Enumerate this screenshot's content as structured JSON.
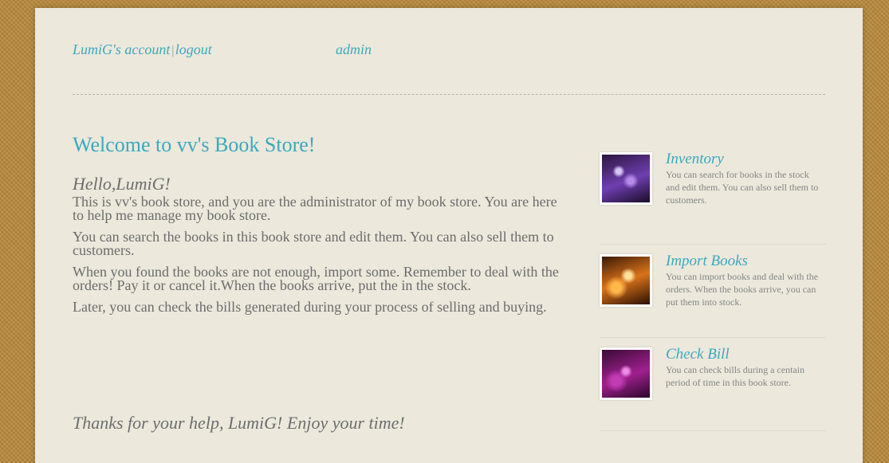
{
  "header": {
    "account_link": "LumiG's account",
    "separator": "|",
    "logout_link": "logout",
    "admin_link": "admin"
  },
  "main": {
    "welcome_title": "Welcome to vv's Book Store!",
    "greeting": "Hello,LumiG!",
    "paragraphs": [
      "This is vv's book store, and you are the administrator of my book store. You are here to help me manage my book store.",
      "You can search the books in this book store and edit them. You can also sell them to customers.",
      "When you found the books are not enough, import some. Remember to deal with the orders! Pay it or cancel it.When the books arrive, put the in the stock.",
      "Later, you can check the bills generated during your process of selling and buying."
    ],
    "thanks": "Thanks for your help, LumiG! Enjoy your time!"
  },
  "sidebar": {
    "items": [
      {
        "title": "Inventory",
        "description": "You can search for books in the stock and edit them. You can also sell them to customers.",
        "icon": "purple-bokeh-thumbnail"
      },
      {
        "title": "Import Books",
        "description": "You can import books and deal with the orders. When the books arrive, you can put them into stock.",
        "icon": "orange-bokeh-thumbnail"
      },
      {
        "title": "Check Bill",
        "description": "You can check bills during a centain period of time in this book store.",
        "icon": "magenta-bokeh-thumbnail"
      }
    ]
  },
  "colors": {
    "accent": "#3aa9bd",
    "page_background": "#ece8dc",
    "outer_background": "#b88a3e",
    "body_text": "#6b6b6b"
  }
}
